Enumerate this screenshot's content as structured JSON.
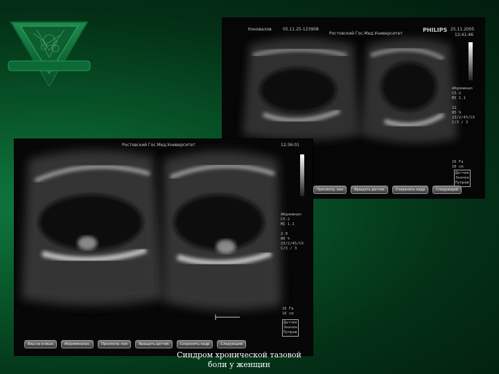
{
  "caption": "Синдром хронической тазовой боли у женщин",
  "top_scan": {
    "patient": "Коновалов",
    "study_id": "05.11.25-123908",
    "institution": "Ростовский Гос.Мед.Университет",
    "brand": "PHILIPS",
    "date": "25.11.2005",
    "time": "12:41:46",
    "sidebar": "Абдоминал\nC5-2\nMI 1.1\n\n11\n85 %\n23/2/45/CX\nC/3 / 3",
    "depth": "16 Fa\n16 cm",
    "menu": [
      "Датчик",
      "Значен",
      "Пуправ"
    ],
    "buttons": [
      "Просмотр. кон",
      "Вращать датчик",
      "Сохранить кадр",
      "Следующий"
    ]
  },
  "bottom_scan": {
    "institution": "Ростовский Гос.Мед.Университет",
    "time": "12:36:01",
    "sidebar": "Абдоминал\nC5-2\nMI 1.1\n\n2.0\n80 %\n23/2/45/CX\nC/3 / 3",
    "depth": "16 Fa\n16 cm",
    "menu": [
      "Датчик",
      "Значен",
      "Пуправ"
    ],
    "buttons": [
      "Вид на клише",
      "Абдоминальн.",
      "Просмотр. кон",
      "Вращать датчик",
      "Сохранить кадр",
      "Следующий"
    ]
  }
}
